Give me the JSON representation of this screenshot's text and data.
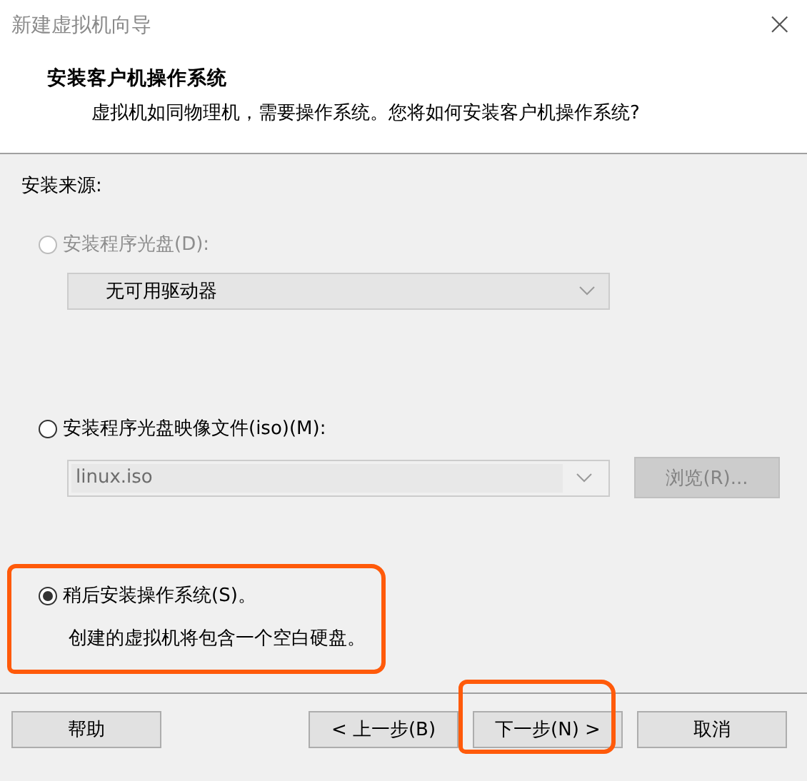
{
  "window": {
    "title": "新建虚拟机向导",
    "close": "×"
  },
  "header": {
    "title": "安装客户机操作系统",
    "subtitle": "虚拟机如同物理机，需要操作系统。您将如何安装客户机操作系统?"
  },
  "source_label": "安装来源:",
  "options": [
    {
      "label": "安装程序光盘(D):",
      "selected": false,
      "disabled": true,
      "highlighted": false,
      "combo": {
        "kind": "dropdown",
        "value": "无可用驱动器",
        "disabled": true
      }
    },
    {
      "label": "安装程序光盘映像文件(iso)(M):",
      "selected": false,
      "disabled": false,
      "highlighted": false,
      "combo": {
        "kind": "editable",
        "value": "linux.iso",
        "disabled": true
      },
      "browse": {
        "label": "浏览(R)...",
        "disabled": true
      }
    },
    {
      "label": "稍后安装操作系统(S)。",
      "selected": true,
      "disabled": false,
      "highlighted": true,
      "description": "创建的虚拟机将包含一个空白硬盘。"
    }
  ],
  "buttons": [
    {
      "label": "帮助",
      "highlighted": false
    },
    {
      "label": "< 上一步(B)",
      "highlighted": false
    },
    {
      "label": "下一步(N) >",
      "highlighted": true
    },
    {
      "label": "取消",
      "highlighted": false
    }
  ]
}
